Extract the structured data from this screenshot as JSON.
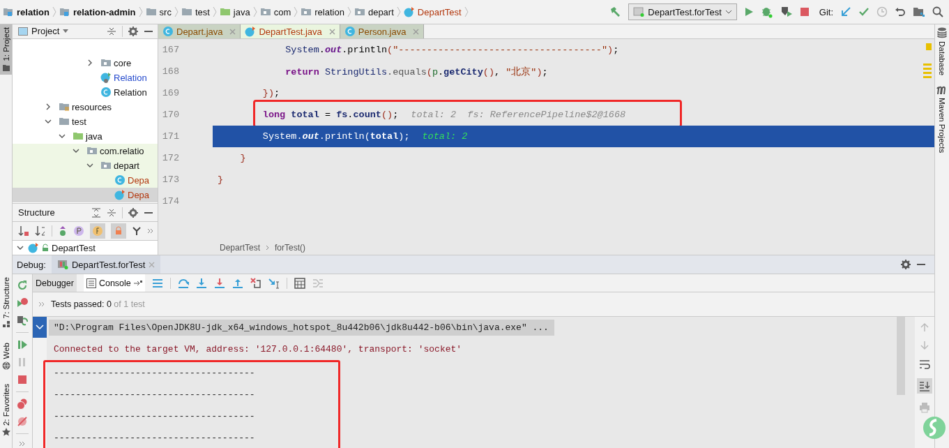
{
  "breadcrumbs": [
    {
      "label": "relation",
      "kind": "module"
    },
    {
      "label": "relation-admin",
      "kind": "module"
    },
    {
      "label": "src",
      "kind": "folder"
    },
    {
      "label": "test",
      "kind": "folder"
    },
    {
      "label": "java",
      "kind": "source-folder"
    },
    {
      "label": "com",
      "kind": "package"
    },
    {
      "label": "relation",
      "kind": "package"
    },
    {
      "label": "depart",
      "kind": "package"
    },
    {
      "label": "DepartTest",
      "kind": "test-class"
    }
  ],
  "run_config": "DepartTest.forTest",
  "vcs_label": "Git:",
  "left_stripe_top": [
    {
      "label": "1: Project",
      "selected": true
    }
  ],
  "left_stripe_bottom": [
    {
      "label": "7: Structure",
      "selected": false
    },
    {
      "label": "Web",
      "selected": false
    },
    {
      "label": "2: Favorites",
      "selected": false
    }
  ],
  "right_stripe": [
    "Database",
    "Maven Projects"
  ],
  "project_panel": {
    "title": "Project",
    "partial_items": [
      {
        "label": "core",
        "kind": "package",
        "expanded": false,
        "selected": false,
        "modified": false,
        "unversioned": false
      },
      {
        "label": "Relation",
        "kind": "runnable-class",
        "selected": false,
        "modified": true,
        "unversioned": false
      },
      {
        "label": "Relation",
        "kind": "class",
        "selected": false,
        "modified": false,
        "unversioned": false
      }
    ],
    "tree": [
      {
        "label": "resources",
        "kind": "resources",
        "expanded": false,
        "selected": false,
        "modified": false,
        "unversioned": false
      },
      {
        "label": "test",
        "kind": "folder",
        "expanded": true,
        "selected": false,
        "modified": false,
        "unversioned": false,
        "children": [
          {
            "label": "java",
            "kind": "test-root",
            "expanded": true,
            "selected": false,
            "modified": false,
            "unversioned": false,
            "children": [
              {
                "label": "com.relatio",
                "kind": "package",
                "expanded": true,
                "selected": false,
                "modified": false,
                "unversioned": false,
                "children": [
                  {
                    "label": "depart",
                    "kind": "package",
                    "expanded": true,
                    "selected": false,
                    "modified": false,
                    "unversioned": false,
                    "children": [
                      {
                        "label": "Depa",
                        "kind": "class",
                        "selected": false,
                        "modified": false,
                        "unversioned": true
                      },
                      {
                        "label": "Depa",
                        "kind": "test-class",
                        "selected": true,
                        "modified": false,
                        "unversioned": true
                      }
                    ]
                  }
                ]
              }
            ]
          }
        ]
      }
    ]
  },
  "structure_panel": {
    "title": "Structure",
    "item": "DepartTest"
  },
  "editor": {
    "tabs": [
      {
        "label": "Depart.java",
        "kind": "class",
        "selected": false
      },
      {
        "label": "DepartTest.java",
        "kind": "test-class",
        "selected": true
      },
      {
        "label": "Person.java",
        "kind": "class",
        "selected": false
      }
    ],
    "lines": [
      {
        "number": "167",
        "selected": false,
        "annotated": false,
        "tokens": [
          {
            "t": "            System",
            "kind": "type"
          },
          {
            "t": ".",
            "kind": "plain"
          },
          {
            "t": "out",
            "kind": "field"
          },
          {
            "t": ".println",
            "kind": "plain"
          },
          {
            "t": "(",
            "kind": "paren"
          },
          {
            "t": "\"------------------------------------\"",
            "kind": "string"
          },
          {
            "t": ")",
            "kind": "paren"
          },
          {
            "t": ";",
            "kind": "plain"
          }
        ]
      },
      {
        "number": "168",
        "selected": false,
        "annotated": false,
        "tokens": [
          {
            "t": "            return",
            "kind": "keyword"
          },
          {
            "t": " StringUtils",
            "kind": "type"
          },
          {
            "t": ".equals",
            "kind": "call"
          },
          {
            "t": "(",
            "kind": "paren"
          },
          {
            "t": "p",
            "kind": "param"
          },
          {
            "t": ".",
            "kind": "plain"
          },
          {
            "t": "getCity",
            "kind": "bold"
          },
          {
            "t": "()",
            "kind": "paren"
          },
          {
            "t": ", ",
            "kind": "plain"
          },
          {
            "t": "\"北京\"",
            "kind": "string"
          },
          {
            "t": ")",
            "kind": "paren"
          },
          {
            "t": ";",
            "kind": "plain"
          }
        ]
      },
      {
        "number": "169",
        "selected": false,
        "annotated": false,
        "tokens": [
          {
            "t": "        })",
            "kind": "paren"
          },
          {
            "t": ";",
            "kind": "plain"
          }
        ]
      },
      {
        "number": "170",
        "selected": false,
        "annotated": true,
        "tokens": [
          {
            "t": "        long",
            "kind": "keyword"
          },
          {
            "t": " total",
            "kind": "bold"
          },
          {
            "t": " = ",
            "kind": "plain"
          },
          {
            "t": "fs",
            "kind": "bold"
          },
          {
            "t": ".",
            "kind": "plain"
          },
          {
            "t": "count",
            "kind": "bold"
          },
          {
            "t": "()",
            "kind": "paren"
          },
          {
            "t": ";",
            "kind": "plain"
          }
        ],
        "hint": "total: 2  fs: ReferencePipeline$2@1668"
      },
      {
        "number": "171",
        "selected": true,
        "annotated": false,
        "tokens": [
          {
            "t": "        System",
            "kind": "type"
          },
          {
            "t": ".",
            "kind": "plain"
          },
          {
            "t": "out",
            "kind": "field"
          },
          {
            "t": ".println",
            "kind": "plain"
          },
          {
            "t": "(",
            "kind": "paren"
          },
          {
            "t": "total",
            "kind": "bold"
          },
          {
            "t": ")",
            "kind": "paren"
          },
          {
            "t": ";",
            "kind": "plain"
          }
        ],
        "hint": "total: 2"
      },
      {
        "number": "172",
        "selected": false,
        "annotated": false,
        "tokens": [
          {
            "t": "    }",
            "kind": "paren"
          }
        ]
      },
      {
        "number": "173",
        "selected": false,
        "annotated": false,
        "tokens": [
          {
            "t": "}",
            "kind": "paren"
          }
        ]
      },
      {
        "number": "174",
        "selected": false,
        "annotated": false
      }
    ],
    "breadcrumb": [
      "DepartTest",
      "forTest()"
    ]
  },
  "debug": {
    "title": "Debug:",
    "session": "DepartTest.forTest",
    "tabs": [
      {
        "label": "Debugger",
        "selected": false
      },
      {
        "label": "Console",
        "selected": true
      }
    ],
    "tests": {
      "passed": "Tests passed: 0",
      "total": " of 1 test"
    },
    "console": [
      {
        "text": "\"D:\\Program Files\\OpenJDK8U-jdk_x64_windows_hotspot_8u442b06\\jdk8u442-b06\\bin\\java.exe\" ...",
        "kind": "command",
        "annotated": false
      },
      {
        "text": "Connected to the target VM, address: '127.0.0.1:64480', transport: 'socket'",
        "kind": "info",
        "annotated": false
      },
      {
        "text": "-------------------------------------",
        "kind": "output",
        "annotated": true
      },
      {
        "text": "-------------------------------------",
        "kind": "output",
        "annotated": true
      },
      {
        "text": "-------------------------------------",
        "kind": "output",
        "annotated": true
      },
      {
        "text": "-------------------------------------",
        "kind": "output",
        "annotated": true
      }
    ]
  }
}
